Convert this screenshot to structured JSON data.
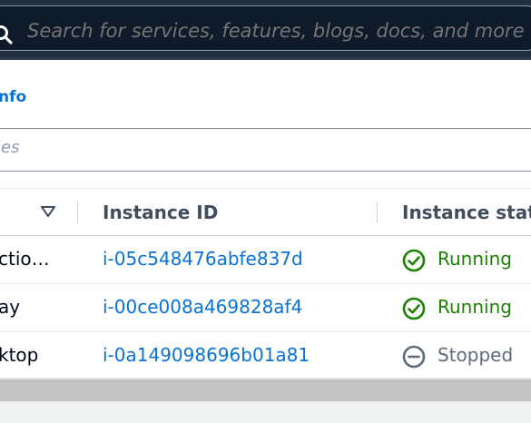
{
  "search": {
    "placeholder": "Search for services, features, blogs, docs, and more"
  },
  "panel": {
    "info_link": "nfo",
    "filter_placeholder": "es"
  },
  "table": {
    "columns": [
      {
        "label": ""
      },
      {
        "label": "Instance ID"
      },
      {
        "label": "Instance state"
      }
    ],
    "rows": [
      {
        "name": "ctio…",
        "instance_id": "i-05c548476abfe837d",
        "state": "Running",
        "state_icon": "check-circle-icon"
      },
      {
        "name": "ay",
        "instance_id": "i-00ce008a469828af4",
        "state": "Running",
        "state_icon": "check-circle-icon"
      },
      {
        "name": "ktop",
        "instance_id": "i-0a149098696b01a81",
        "state": "Stopped",
        "state_icon": "minus-circle-icon"
      }
    ]
  },
  "colors": {
    "running": "#1d8102",
    "stopped": "#5f6b7a",
    "link": "#0972d3",
    "topbar": "#232f3e"
  }
}
